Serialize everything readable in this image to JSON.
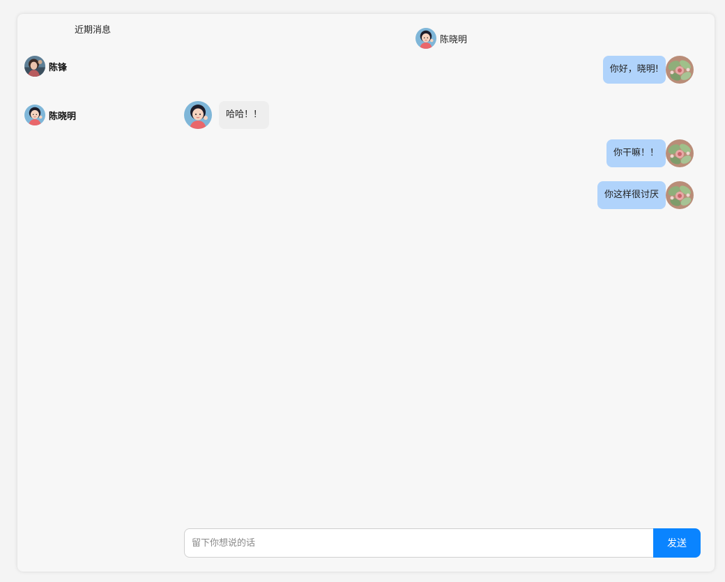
{
  "sidebar": {
    "title": "近期消息",
    "contacts": [
      {
        "name": "陈锋",
        "avatar": "girl-sunset-avatar"
      },
      {
        "name": "陈晓明",
        "avatar": "girl-blue-sky-avatar"
      }
    ]
  },
  "chat": {
    "header_name": "陈晓明",
    "header_avatar": "girl-blue-sky-avatar",
    "messages": [
      {
        "from": "me",
        "text": "你好，晓明!",
        "avatar": "flower-avatar"
      },
      {
        "from": "them",
        "text": "哈哈！！",
        "avatar": "girl-blue-sky-avatar"
      },
      {
        "from": "me",
        "text": "你干嘛！！",
        "avatar": "flower-avatar"
      },
      {
        "from": "me",
        "text": "你这样很讨厌",
        "avatar": "flower-avatar"
      }
    ]
  },
  "composer": {
    "placeholder": "留下你想说的话",
    "value": "",
    "send_label": "发送"
  },
  "colors": {
    "my_bubble": "#b0d3fb",
    "their_bubble": "#eeeeee",
    "send_button": "#0a84ff",
    "card_background": "#f7f7f7"
  }
}
